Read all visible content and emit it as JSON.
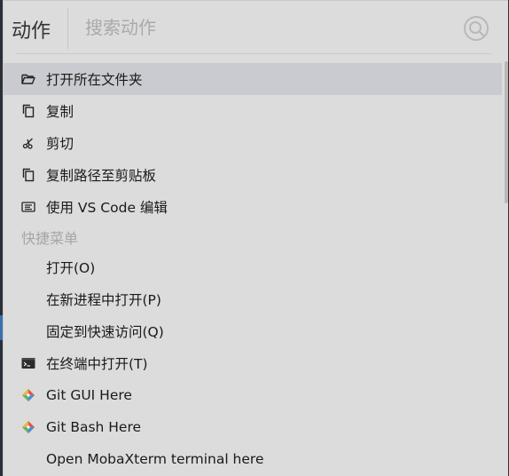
{
  "header": {
    "title": "动作",
    "search_placeholder": "搜索动作",
    "search_icon": "search-icon"
  },
  "actions": [
    {
      "label": "打开所在文件夹",
      "icon": "folder-open-icon"
    },
    {
      "label": "复制",
      "icon": "copy-icon"
    },
    {
      "label": "剪切",
      "icon": "scissors-icon"
    },
    {
      "label": "复制路径至剪贴板",
      "icon": "copy-path-icon"
    },
    {
      "label": "使用 VS Code 编辑",
      "icon": "vscode-icon"
    }
  ],
  "quick_menu": {
    "header": "快捷菜单",
    "items": [
      {
        "label": "打开(O)"
      },
      {
        "label": "在新进程中打开(P)"
      },
      {
        "label": "固定到快速访问(Q)"
      },
      {
        "label": "在终端中打开(T)",
        "icon": "terminal-icon"
      },
      {
        "label": "Git GUI Here",
        "icon": "git-icon"
      },
      {
        "label": "Git Bash Here",
        "icon": "git-icon"
      },
      {
        "label": "Open MobaXterm terminal here"
      }
    ]
  },
  "colors": {
    "panel_bg": "#dcdcdc",
    "selected_bg": "#c9cbd0",
    "section_header": "#a6a6a6",
    "git_red": "#e05a47",
    "git_blue": "#4a8fd8",
    "git_green": "#5bb66a",
    "git_yellow": "#e8b93a"
  }
}
